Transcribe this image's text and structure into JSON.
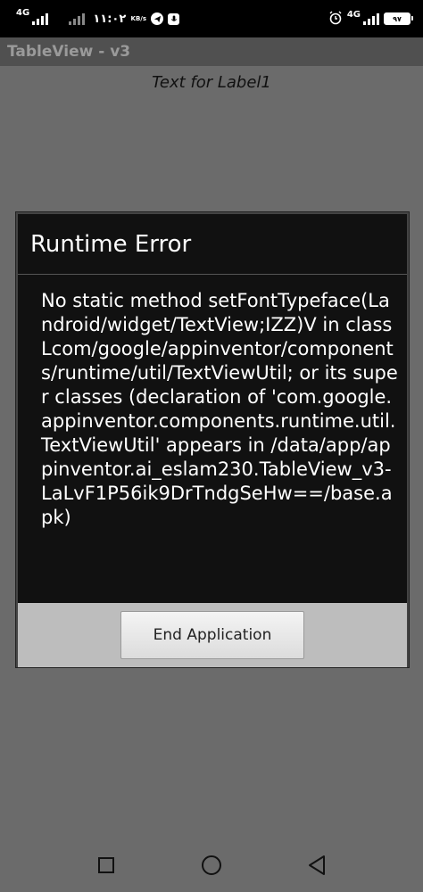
{
  "status_bar": {
    "network_1": "4G",
    "network_2": "4G",
    "time": "١١:٠٢",
    "speed_unit": "KB/s",
    "right_network": "4G",
    "battery_level": "٩٧"
  },
  "app": {
    "title": "TableView - v3",
    "label1": "Text for Label1"
  },
  "dialog": {
    "title": "Runtime Error",
    "message": "No static method setFontTypeface(Landroid/widget/TextView;IZZ)V in class Lcom/google/appinventor/components/runtime/util/TextViewUtil; or its super classes (declaration of 'com.google.appinventor.components.runtime.util.TextViewUtil' appears in /data/app/appinventor.ai_eslam230.TableView_v3-LaLvF1P56ik9DrTndgSeHw==/base.apk)",
    "button_label": "End Application"
  },
  "nav": {
    "icons": [
      "square-icon",
      "circle-icon",
      "triangle-back-icon"
    ]
  },
  "colors": {
    "background": "#6b6b6b",
    "dialog_bg": "#111111",
    "button_bar": "#bdbdbd"
  }
}
